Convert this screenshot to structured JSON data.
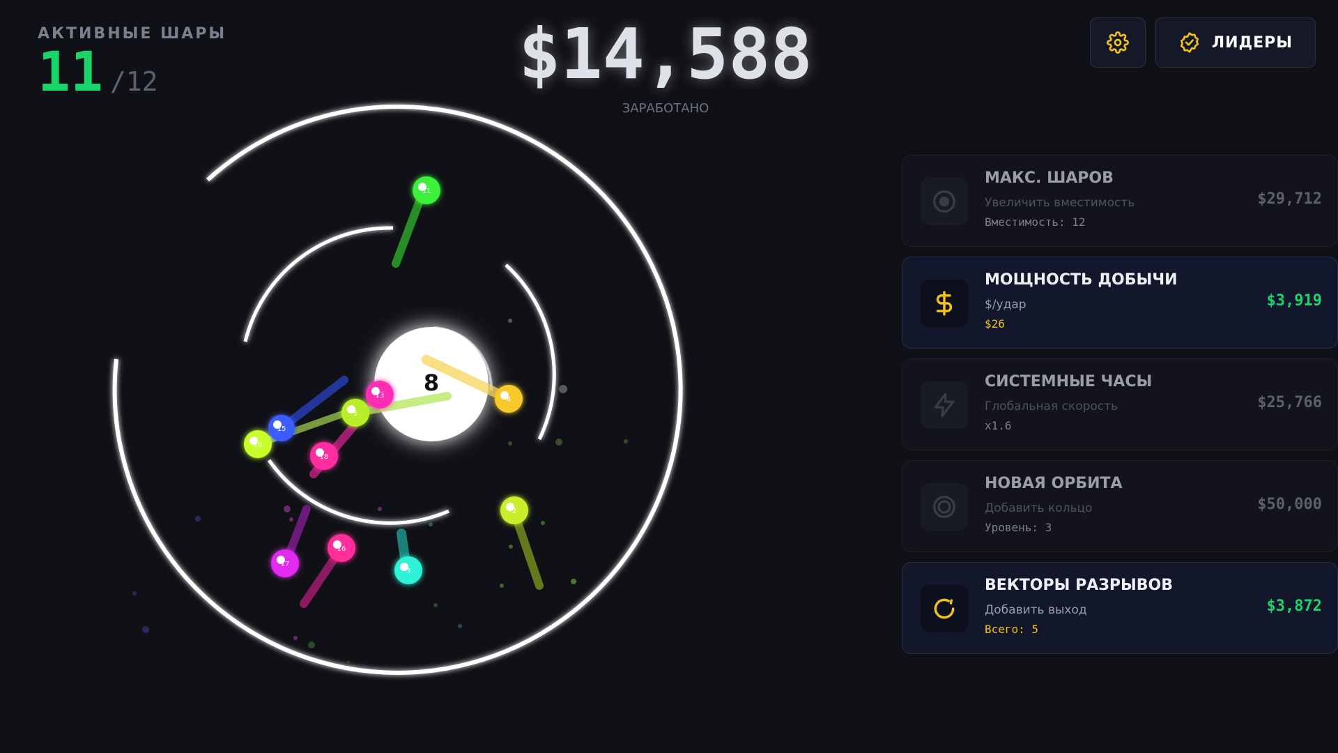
{
  "hud": {
    "active_label": "АКТИВНЫЕ ШАРЫ",
    "active_count": "11",
    "active_max": "/12",
    "money": "$14,588",
    "money_caption": "ЗАРАБОТАНО"
  },
  "buttons": {
    "settings_icon": "gear-icon",
    "leaders_icon": "badge-check-icon",
    "leaders_label": "ЛИДЕРЫ"
  },
  "game": {
    "center_number": "8",
    "balls": [
      {
        "label": "11",
        "color": "#3df03a"
      },
      {
        "label": "4",
        "color": "#f8c92a"
      },
      {
        "label": "13",
        "color": "#ff2fb4"
      },
      {
        "label": "5",
        "color": "#b9ef2a"
      },
      {
        "label": "15",
        "color": "#3a5cff"
      },
      {
        "label": "10",
        "color": "#c8ff2a"
      },
      {
        "label": "18",
        "color": "#ff2fa0"
      },
      {
        "label": "2",
        "color": "#c9ef2a"
      },
      {
        "label": "17",
        "color": "#e22cf0"
      },
      {
        "label": "16",
        "color": "#ff2f9a"
      },
      {
        "label": "3",
        "color": "#2ff3d8"
      }
    ]
  },
  "upgrades": [
    {
      "title": "МАКС. ШАРОВ",
      "desc": "Увеличить вместимость",
      "stat": "Вместимость: 12",
      "price": "$29,712",
      "icon": "target-icon",
      "affordable": false
    },
    {
      "title": "МОЩНОСТЬ ДОБЫЧИ",
      "desc": "$/удар",
      "stat": "$26",
      "price": "$3,919",
      "icon": "dollar-icon",
      "affordable": true
    },
    {
      "title": "СИСТЕМНЫЕ ЧАСЫ",
      "desc": "Глобальная скорость",
      "stat": "x1.6",
      "price": "$25,766",
      "icon": "lightning-icon",
      "affordable": false
    },
    {
      "title": "НОВАЯ ОРБИТА",
      "desc": "Добавить кольцо",
      "stat": "Уровень: 3",
      "price": "$50,000",
      "icon": "rings-icon",
      "affordable": false
    },
    {
      "title": "ВЕКТОРЫ РАЗРЫВОВ",
      "desc": "Добавить выход",
      "stat": "Всего: 5",
      "price": "$3,872",
      "icon": "refresh-icon",
      "affordable": true
    }
  ],
  "colors": {
    "accent_green": "#19d46b",
    "accent_yellow": "#f2c21a",
    "background": "#101116"
  }
}
